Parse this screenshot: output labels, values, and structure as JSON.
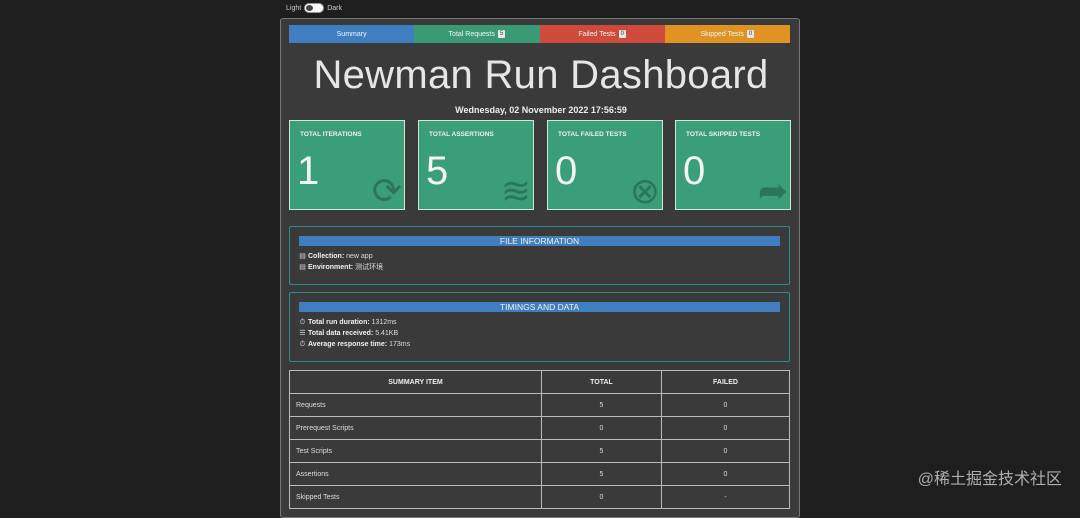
{
  "theme": {
    "light_label": "Light",
    "dark_label": "Dark"
  },
  "nav": {
    "summary": "Summary",
    "requests": "Total Requests",
    "requests_count": "5",
    "failed": "Failed Tests",
    "failed_count": "0",
    "skipped": "Skipped Tests",
    "skipped_count": "0"
  },
  "header": {
    "title": "Newman Run Dashboard",
    "date": "Wednesday, 02 November 2022 17:56:59"
  },
  "cards": [
    {
      "label": "TOTAL ITERATIONS",
      "value": "1",
      "icon": "refresh-icon"
    },
    {
      "label": "TOTAL ASSERTIONS",
      "value": "5",
      "icon": "tasks-icon"
    },
    {
      "label": "TOTAL FAILED TESTS",
      "value": "0",
      "icon": "times-circle-icon"
    },
    {
      "label": "TOTAL SKIPPED TESTS",
      "value": "0",
      "icon": "share-icon"
    }
  ],
  "file_info": {
    "header": "FILE INFORMATION",
    "collection_label": "Collection:",
    "collection_value": "new app",
    "environment_label": "Environment:",
    "environment_value": "测试环境"
  },
  "timings": {
    "header": "TIMINGS AND DATA",
    "duration_label": "Total run duration:",
    "duration_value": "1312ms",
    "data_label": "Total data received:",
    "data_value": "5.41KB",
    "response_label": "Average response time:",
    "response_value": "173ms"
  },
  "summary_table": {
    "headers": [
      "SUMMARY ITEM",
      "TOTAL",
      "FAILED"
    ],
    "rows": [
      [
        "Requests",
        "5",
        "0"
      ],
      [
        "Prerequest Scripts",
        "0",
        "0"
      ],
      [
        "Test Scripts",
        "5",
        "0"
      ],
      [
        "Assertions",
        "5",
        "0"
      ],
      [
        "Skipped Tests",
        "0",
        "-"
      ]
    ]
  },
  "watermark": "@稀土掘金技术社区",
  "colors": {
    "summary": "#3f7fbf",
    "requests": "#3a9a75",
    "failed": "#cf4a3a",
    "skipped": "#e09222",
    "card": "#3a9e78"
  }
}
